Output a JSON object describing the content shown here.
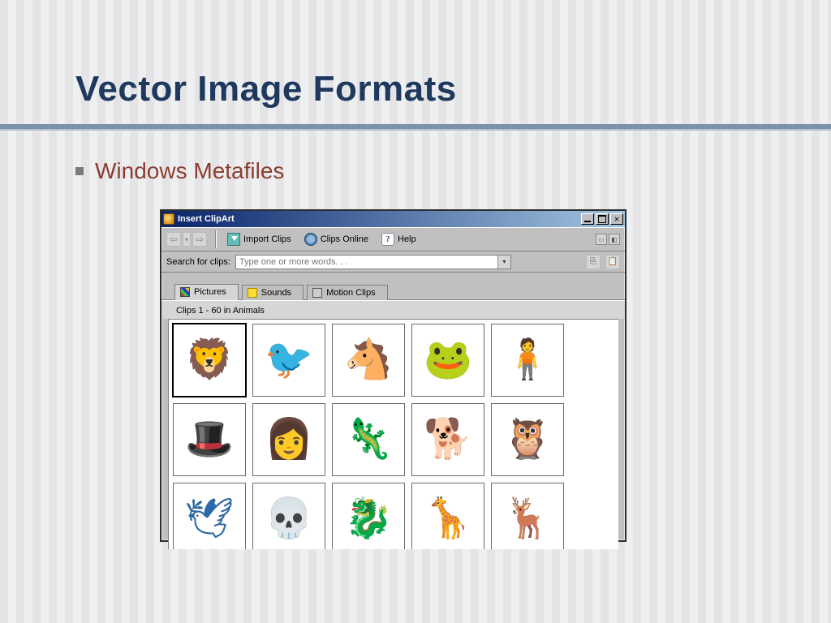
{
  "slide": {
    "title": "Vector Image Formats",
    "subtitle": "Windows Metafiles"
  },
  "window": {
    "title": "Insert ClipArt",
    "toolbar": {
      "import": "Import Clips",
      "online": "Clips Online",
      "help": "Help"
    },
    "search": {
      "label": "Search for clips:",
      "placeholder": "Type one or more words. . ."
    },
    "tabs": {
      "pictures": "Pictures",
      "sounds": "Sounds",
      "motion": "Motion Clips"
    },
    "status": "Clips 1 - 60 in Animals",
    "clips": [
      {
        "name": "lion",
        "glyph": "🦁",
        "cls": "g-lion",
        "sel": true
      },
      {
        "name": "heron",
        "glyph": "🐦",
        "cls": "g-heron"
      },
      {
        "name": "horse-head",
        "glyph": "🐴",
        "cls": "g-horse"
      },
      {
        "name": "frog",
        "glyph": "🐸",
        "cls": "g-frog"
      },
      {
        "name": "hunter",
        "glyph": "🧍",
        "cls": "g-hunter"
      },
      {
        "name": "magician-rabbit",
        "glyph": "🎩",
        "cls": "g-magic"
      },
      {
        "name": "vet-with-dog",
        "glyph": "👩",
        "cls": "g-vet"
      },
      {
        "name": "dinosaur",
        "glyph": "🦎",
        "cls": "g-dino"
      },
      {
        "name": "dog",
        "glyph": "🐕",
        "cls": "g-dog"
      },
      {
        "name": "owl-reading",
        "glyph": "🦉",
        "cls": "g-owl"
      },
      {
        "name": "bird-flying",
        "glyph": "🕊",
        "cls": "g-bird"
      },
      {
        "name": "cattle-skull",
        "glyph": "💀",
        "cls": "g-skull"
      },
      {
        "name": "dragon",
        "glyph": "🐉",
        "cls": "g-dragon"
      },
      {
        "name": "giraffe",
        "glyph": "🦒",
        "cls": "g-giraffe"
      },
      {
        "name": "antelope",
        "glyph": "🦌",
        "cls": "g-ante"
      }
    ]
  }
}
